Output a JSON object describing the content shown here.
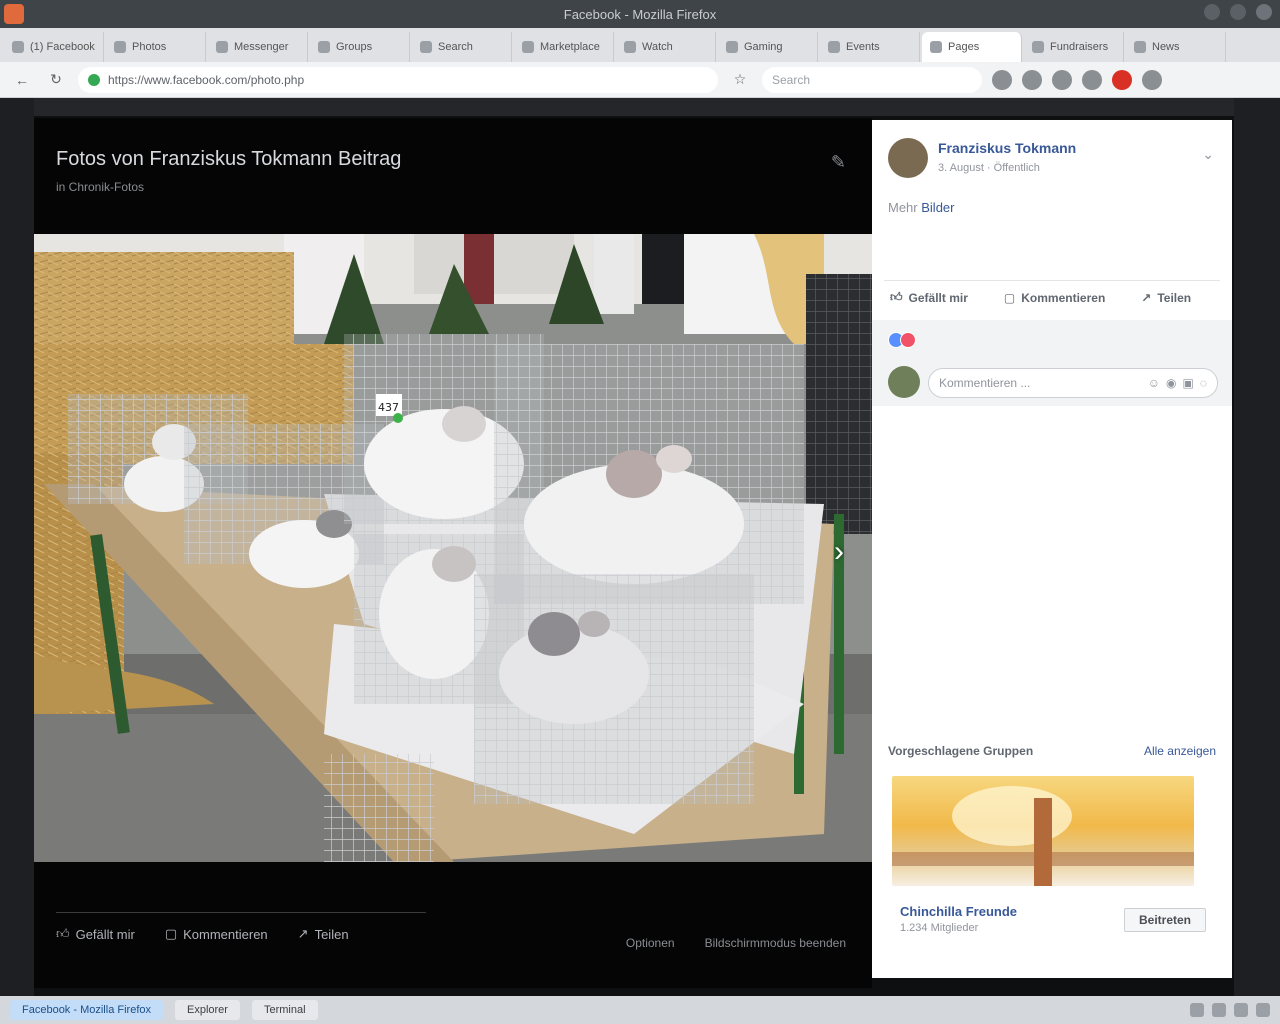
{
  "browser": {
    "window_title": "Facebook - Mozilla Firefox",
    "tabs": [
      {
        "label": "(1) Facebook",
        "active": false
      },
      {
        "label": "Photos",
        "active": false
      },
      {
        "label": "Messenger",
        "active": false
      },
      {
        "label": "Groups",
        "active": false
      },
      {
        "label": "Search",
        "active": false
      },
      {
        "label": "Marketplace",
        "active": false
      },
      {
        "label": "Watch",
        "active": false
      },
      {
        "label": "Gaming",
        "active": false
      },
      {
        "label": "Events",
        "active": false
      },
      {
        "label": "Pages",
        "active": true
      },
      {
        "label": "Fundraisers",
        "active": false
      },
      {
        "label": "News",
        "active": false
      }
    ],
    "address": "https://www.facebook.com/photo.php",
    "search_placeholder": "Search"
  },
  "photo_view": {
    "title": "Fotos von Franziskus Tokmann Beitrag",
    "subtitle": "in Chronik-Fotos",
    "footer_actions": [
      "Gefällt mir",
      "Kommentieren",
      "Teilen"
    ],
    "footer_links": [
      "Optionen",
      "Bildschirmmodus beenden"
    ],
    "cage_tag": "437"
  },
  "post": {
    "author": "Franziskus Tokmann",
    "time": "3. August · Öffentlich",
    "caption_prefix": "Mehr",
    "caption_link": "Bilder",
    "actions": [
      "Gefällt mir",
      "Kommentieren",
      "Teilen"
    ],
    "comment_placeholder": "Kommentieren ...",
    "related_heading": "Vorgeschlagene Gruppen",
    "related_link": "Alle anzeigen",
    "related_name": "Chinchilla Freunde",
    "related_meta": "1.234 Mitglieder",
    "related_button": "Beitreten"
  },
  "taskbar": {
    "items": [
      "Facebook - Mozilla Firefox",
      "Explorer",
      "Terminal"
    ]
  },
  "colors": {
    "fb_blue": "#385898",
    "overlay": "#0e0f10",
    "sidebar_bg": "#ffffff"
  }
}
